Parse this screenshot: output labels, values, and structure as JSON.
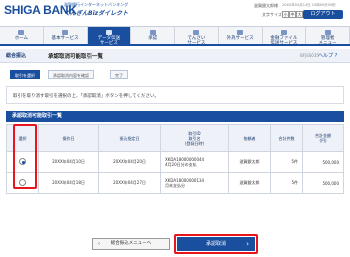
{
  "header": {
    "bank_name": "SHIGA BANK",
    "tagline": "滋賀銀行インターネットバンキング",
    "service": "てんぎんBizダイレクト",
    "user_name": "滋賀銀太郎",
    "user_suffix": "様",
    "last_login": "20XX年04月14日 10時00分00秒",
    "font_size_label": "文字サイズ",
    "size_small": "小",
    "size_medium": "中",
    "size_large": "大",
    "logout": "ログアウト"
  },
  "nav": [
    {
      "label": "ホーム",
      "active": false
    },
    {
      "label": "基本サービス",
      "active": false
    },
    {
      "label": "データ伝送\nサービス",
      "active": true
    },
    {
      "label": "承認",
      "active": false
    },
    {
      "label": "でんさい\nサービス",
      "active": false
    },
    {
      "label": "外為サービス",
      "active": false
    },
    {
      "label": "金融ファイル\n伝送サービス",
      "active": false
    },
    {
      "label": "管理者\nメニュー",
      "active": false
    }
  ],
  "page": {
    "category": "総合振込",
    "title": "承認取消可能取引一覧",
    "screen_code": "BFJSS035",
    "help": "ヘルプ"
  },
  "steps": [
    "取引を選択",
    "承認取消内容を確認",
    "完了"
  ],
  "notice": "取引を取り消す取引を選択の上、「承認取消」ボタンを押してください。",
  "section_title": "承認取消可能取引一覧",
  "table": {
    "headers": [
      "選択",
      "操作日",
      "振込指定日",
      "取引ID\n取引名\n(登録日時)",
      "依頼者",
      "合計件数",
      "合計金額\n(円)"
    ],
    "rows": [
      {
        "selected": true,
        "op_date": "20XX年04月10日",
        "transfer_date": "20XX年04月20日",
        "trade_id": "XKDA18000000044",
        "trade_name": "4月20日分の支払",
        "requester": "滋賀銀太郎",
        "count": "5件",
        "amount": "500,000"
      },
      {
        "selected": false,
        "op_date": "20XX年04月18日",
        "transfer_date": "20XX年04月27日",
        "trade_id": "XKDA18000000134",
        "trade_name": "月末支払分",
        "requester": "滋賀銀太郎",
        "count": "5件",
        "amount": "500,000"
      }
    ]
  },
  "buttons": {
    "back": "総合振込メニューへ",
    "confirm": "承認取消"
  },
  "colors": {
    "brand": "#1a4fa0",
    "highlight": "#e8141e"
  }
}
